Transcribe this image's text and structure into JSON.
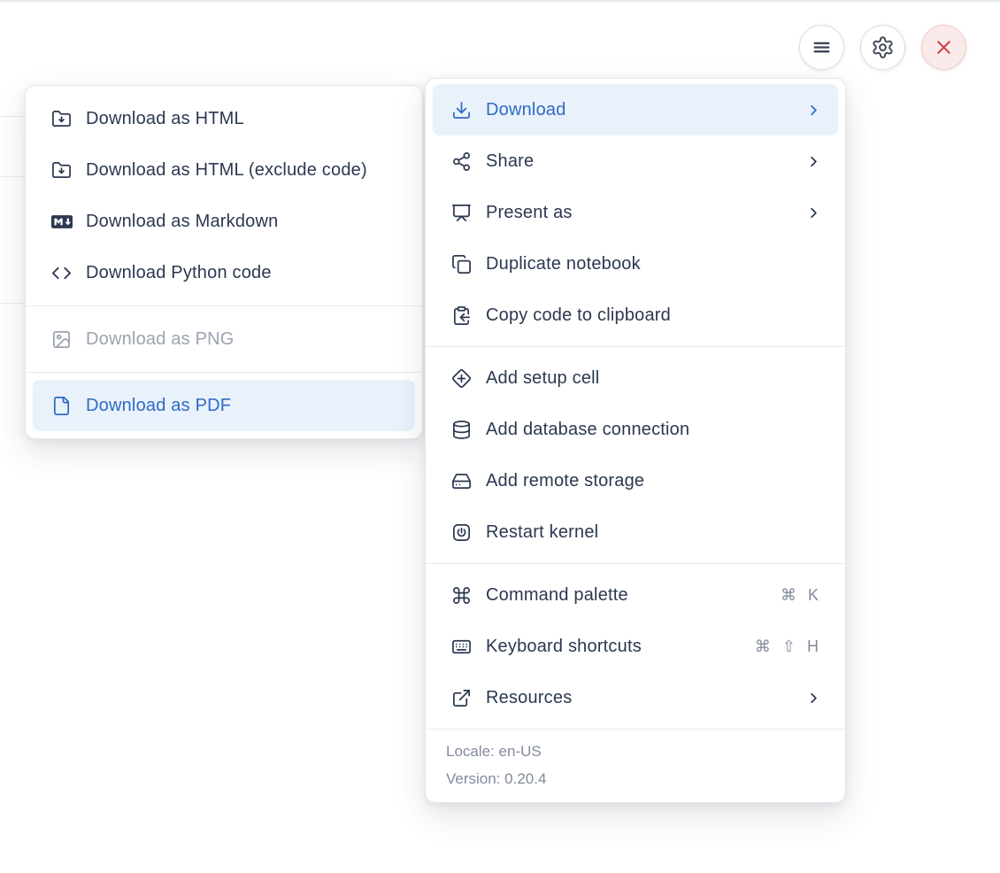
{
  "toolbar": {
    "buttons": [
      {
        "id": "menu",
        "icon": "hamburger-icon"
      },
      {
        "id": "settings",
        "icon": "gear-icon"
      },
      {
        "id": "close",
        "icon": "close-icon"
      }
    ]
  },
  "download_submenu": {
    "groups": [
      {
        "items": [
          {
            "label": "Download as HTML",
            "icon": "folder-download-icon"
          },
          {
            "label": "Download as HTML (exclude code)",
            "icon": "folder-download-icon"
          },
          {
            "label": "Download as Markdown",
            "icon": "markdown-icon"
          },
          {
            "label": "Download Python code",
            "icon": "code-icon"
          }
        ]
      },
      {
        "items": [
          {
            "label": "Download as PNG",
            "icon": "image-icon",
            "disabled": true
          }
        ]
      },
      {
        "items": [
          {
            "label": "Download as PDF",
            "icon": "file-icon",
            "highlighted": true
          }
        ]
      }
    ]
  },
  "main_menu": {
    "groups": [
      {
        "items": [
          {
            "label": "Download",
            "icon": "download-icon",
            "highlighted": true,
            "submenu": true
          },
          {
            "label": "Share",
            "icon": "share-icon",
            "submenu": true
          },
          {
            "label": "Present as",
            "icon": "presentation-icon",
            "submenu": true
          },
          {
            "label": "Duplicate notebook",
            "icon": "duplicate-icon"
          },
          {
            "label": "Copy code to clipboard",
            "icon": "clipboard-copy-icon"
          }
        ]
      },
      {
        "items": [
          {
            "label": "Add setup cell",
            "icon": "diamond-plus-icon"
          },
          {
            "label": "Add database connection",
            "icon": "database-icon"
          },
          {
            "label": "Add remote storage",
            "icon": "hard-drive-icon"
          },
          {
            "label": "Restart kernel",
            "icon": "power-icon"
          }
        ]
      },
      {
        "items": [
          {
            "label": "Command palette",
            "icon": "command-icon",
            "shortcut": "⌘ K"
          },
          {
            "label": "Keyboard shortcuts",
            "icon": "keyboard-icon",
            "shortcut": "⌘ ⇧ H"
          },
          {
            "label": "Resources",
            "icon": "external-link-icon",
            "submenu": true
          }
        ]
      }
    ],
    "footer": {
      "locale": "Locale: en-US",
      "version": "Version: 0.20.4"
    }
  },
  "colors": {
    "text": "#2b3850",
    "accent": "#2f6ac4",
    "accent_bg": "#e9f1fb",
    "muted": "#828b9c",
    "disabled": "#9ba3b0",
    "danger": "#cf4444",
    "danger_bg": "#fbeaea"
  }
}
